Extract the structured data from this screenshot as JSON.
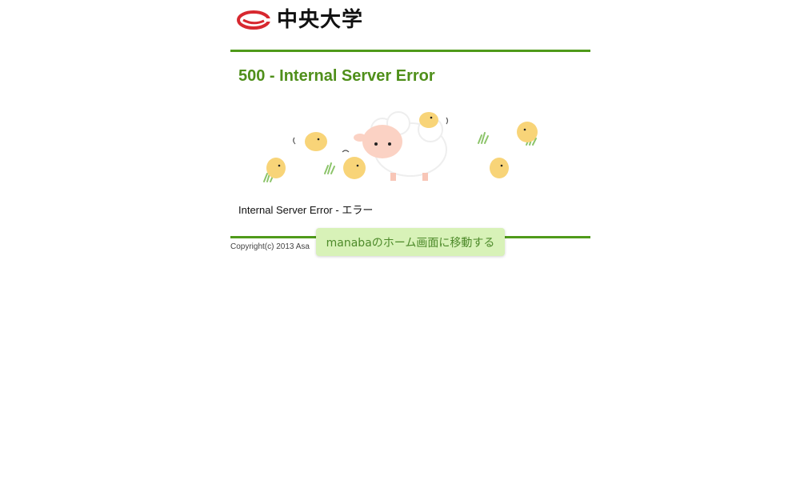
{
  "header": {
    "logo_text": "中央大学",
    "logo_mark_color": "#d7282f"
  },
  "error": {
    "title": "500 - Internal Server Error",
    "message": "Internal Server Error - エラー"
  },
  "footer": {
    "copyright": "Copyright(c) 2013 Asa"
  },
  "home_button": {
    "label": "manabaのホーム画面に移動する"
  },
  "colors": {
    "accent_green": "#4f9a1a",
    "button_bg": "#d8f2b8",
    "button_text": "#4d8a2a"
  },
  "icons": {
    "logo": "chuo-university-logo-mark",
    "illustration": "sheep-and-chicks-illustration"
  }
}
